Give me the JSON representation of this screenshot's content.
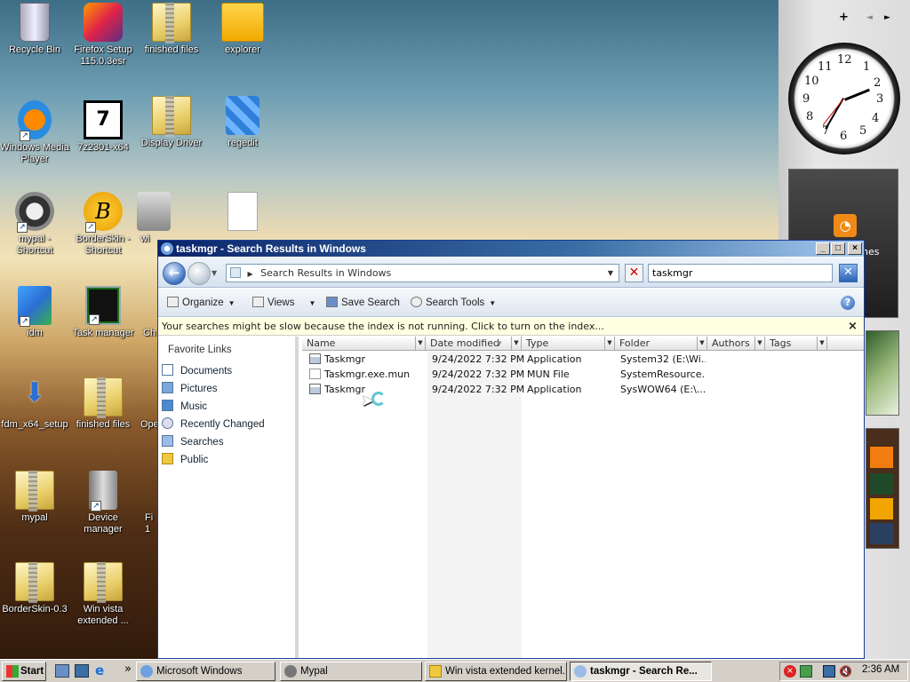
{
  "desktop": {
    "icons": [
      {
        "label": "Recycle Bin",
        "icon": "recycle-bin-icon"
      },
      {
        "label": "Firefox Setup 115.0.3esr",
        "icon": "firefox-setup-icon"
      },
      {
        "label": "finished files",
        "icon": "zip-folder-icon"
      },
      {
        "label": "explorer",
        "icon": "folder-icon"
      },
      {
        "label": "Windows Media Player",
        "icon": "media-player-icon"
      },
      {
        "label": "7z2301-x64",
        "icon": "7zip-installer-icon"
      },
      {
        "label": "Display Driver",
        "icon": "zip-folder-icon"
      },
      {
        "label": "regedit",
        "icon": "regedit-icon"
      },
      {
        "label": "mypal - Shortcut",
        "icon": "mypal-icon"
      },
      {
        "label": "BorderSkin - Shortcut",
        "icon": "borderskin-icon"
      },
      {
        "label": "wi",
        "icon": "installer-icon"
      },
      {
        "label": "idm",
        "icon": "idm-icon"
      },
      {
        "label": "Task manager",
        "icon": "task-manager-icon"
      },
      {
        "label": "Ch",
        "icon": "file-icon"
      },
      {
        "label": "fdm_x64_setup",
        "icon": "download-icon"
      },
      {
        "label": "finished files",
        "icon": "zip-folder-icon"
      },
      {
        "label": "Ope",
        "icon": "file-icon"
      },
      {
        "label": "mypal",
        "icon": "zip-folder-icon"
      },
      {
        "label": "Device manager",
        "icon": "device-manager-icon"
      },
      {
        "label": "Fi 1",
        "icon": "file-icon"
      },
      {
        "label": "BorderSkin-0.3",
        "icon": "zip-folder-icon"
      },
      {
        "label": "Win vista extended ...",
        "icon": "zip-folder-icon"
      }
    ]
  },
  "sidebar": {
    "add_label": "+",
    "prev_label": "◄",
    "next_label": "►",
    "clock_numbers": [
      "12",
      "1",
      "2",
      "3",
      "4",
      "5",
      "6",
      "7",
      "8",
      "9",
      "10",
      "11"
    ],
    "feed_label": "nes"
  },
  "window": {
    "title": "taskmgr - Search Results in Windows",
    "address": "Search Results in Windows",
    "search_value": "taskmgr",
    "toolbar": {
      "organize": "Organize",
      "views": "Views",
      "save_search": "Save Search",
      "search_tools": "Search Tools"
    },
    "info_message": "Your searches might be slow because the index is not running.  Click to turn on the index...",
    "nav": {
      "heading": "Favorite Links",
      "items": [
        "Documents",
        "Pictures",
        "Music",
        "Recently Changed",
        "Searches",
        "Public"
      ]
    },
    "columns": [
      "Name",
      "Date modified",
      "Type",
      "Folder",
      "Authors",
      "Tags"
    ],
    "rows": [
      {
        "name": "Taskmgr",
        "date": "9/24/2022 7:32 PM",
        "type": "Application",
        "folder": "System32 (E:\\Wi..."
      },
      {
        "name": "Taskmgr.exe.mun",
        "date": "9/24/2022 7:32 PM",
        "type": "MUN File",
        "folder": "SystemResource..."
      },
      {
        "name": "Taskmgr",
        "date": "9/24/2022 7:32 PM",
        "type": "Application",
        "folder": "SysWOW64 (E:\\..."
      }
    ]
  },
  "taskbar": {
    "start": "Start",
    "quicklaunch_more": "»",
    "buttons": [
      {
        "label": "Microsoft Windows",
        "active": false
      },
      {
        "label": "Mypal",
        "active": false
      },
      {
        "label": "Win vista extended kernel...",
        "active": false
      },
      {
        "label": "taskmgr - Search Re...",
        "active": true
      }
    ],
    "clock": "2:36 AM"
  },
  "colors": {
    "accent": "#0a246a",
    "info_bg": "#ffffe1"
  }
}
